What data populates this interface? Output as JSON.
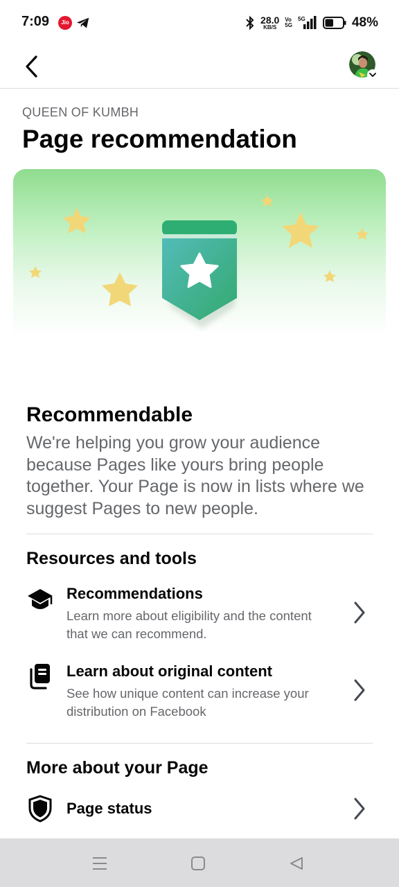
{
  "status_bar": {
    "time": "7:09",
    "carrier_icon": "jio-icon",
    "carrier_label": "Jio",
    "notification_icon": "telegram-icon",
    "net_speed": "28.0",
    "net_speed_unit": "KB/S",
    "volte_top": "Vo",
    "volte_bottom": "5G",
    "network": "5G",
    "battery_percent": "48%",
    "battery_level": 0.48
  },
  "header": {
    "back_icon": "back-arrow-icon",
    "avatar_icon": "profile-avatar",
    "avatar_menu_icon": "chevron-down-icon"
  },
  "page": {
    "page_name": "QUEEN OF KUMBH",
    "title": "Page recommendation"
  },
  "hero": {
    "badge_icon": "star-badge-icon",
    "accent_colors": [
      "#2fae73",
      "#45b7b0",
      "#f2d778"
    ]
  },
  "recommendable": {
    "title": "Recommendable",
    "description": "We're helping you grow your audience because Pages like yours bring people together. Your Page is now in lists where we suggest Pages to new people."
  },
  "resources": {
    "title": "Resources and tools",
    "items": [
      {
        "icon": "graduation-cap-icon",
        "label": "Recommendations",
        "description": "Learn more about eligibility and the content that we can recommend."
      },
      {
        "icon": "original-content-icon",
        "label": "Learn about original content",
        "description": "See how unique content can increase your distribution on Facebook"
      }
    ]
  },
  "more": {
    "title": "More about your Page",
    "items": [
      {
        "icon": "shield-icon",
        "label": "Page status"
      }
    ]
  },
  "nav_bar": {
    "menu_icon": "menu-icon",
    "home_icon": "home-square-icon",
    "back_icon": "back-triangle-icon"
  }
}
